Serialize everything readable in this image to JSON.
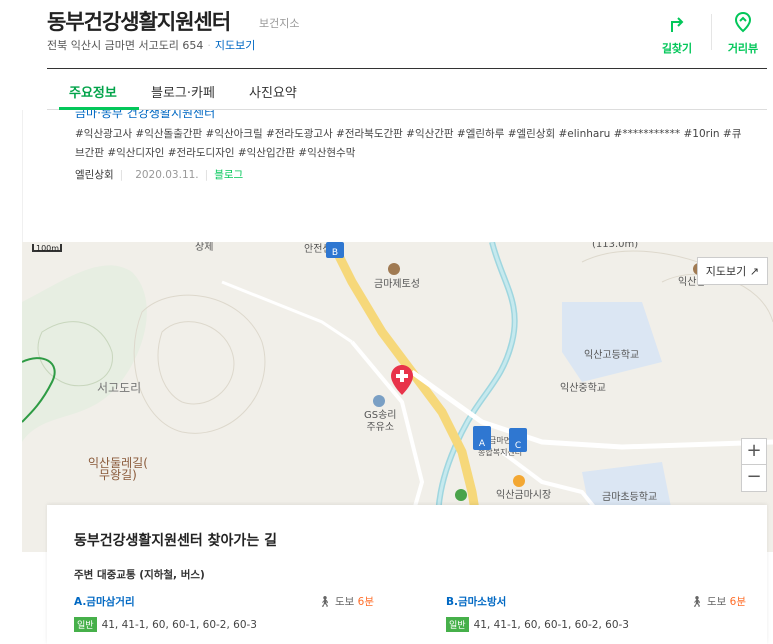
{
  "header": {
    "title": "동부건강생활지원센터",
    "category": "보건지소",
    "address": "전북 익산시 금마면 서고도리 654",
    "map_link": "지도보기",
    "actions": {
      "directions": "길찾기",
      "distance": "거리뷰"
    },
    "accent_color": "#03c75a"
  },
  "tabs": [
    "주요정보",
    "블로그·카페",
    "사진요약"
  ],
  "blog": {
    "title": "금마·동부 건강생활지원센터",
    "tags": "#익산광고사 #익산돌출간판 #익산아크릴 #전라도광고사 #전라북도간판 #익산간판 #엘린하루 #엘린상회 #elinharu #*********** #10rin #큐브간판 #익산디자인 #전라도디자인 #익산입간판 #익산현수막",
    "author": "엘린상회",
    "date": "2020.03.11.",
    "source": "블로그"
  },
  "map": {
    "scale": "100m",
    "view_button": "지도보기",
    "labels": {
      "stop_top": "안전센",
      "geumma_post": "금마제토성",
      "seogodori": "서고도리",
      "gs": "GS송리\n주유소",
      "high_school": "익산고등학교",
      "middle_school": "익산중학교",
      "elementary": "금마초등학교",
      "market": "익산금마시장",
      "walkway": "익산둘레길(\n무왕길)",
      "top_left": "상제",
      "top_right": "(113.0m)",
      "far_right": "익산남",
      "center_small": "금마면\n종합복지센터"
    },
    "zoom_in": "+",
    "zoom_out": "−"
  },
  "directions": {
    "title": "동부건강생활지원센터 찾아가는 길",
    "subtitle": "주변 대중교통 (지하철, 버스)",
    "stops": [
      {
        "name": "A.금마삼거리",
        "walk": "도보",
        "minutes": "6분",
        "badge": "일반",
        "routes": "41,  41-1,  60,  60-1,  60-2,  60-3"
      },
      {
        "name": "B.금마소방서",
        "walk": "도보",
        "minutes": "6분",
        "badge": "일반",
        "routes": "41,  41-1,  60,  60-1,  60-2,  60-3"
      }
    ]
  }
}
